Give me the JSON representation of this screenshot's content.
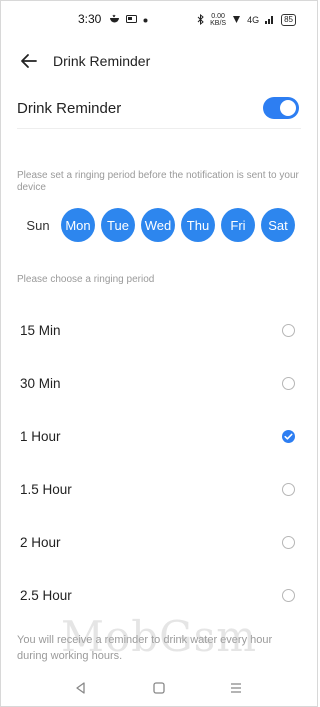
{
  "status_bar": {
    "time": "3:30",
    "notification_icons": [
      "rice-bowl-icon",
      "cast-icon",
      "dot-icon"
    ],
    "speed_value": "0.00",
    "speed_unit": "KB/S",
    "network": "4G",
    "battery": "85"
  },
  "header": {
    "title": "Drink Reminder"
  },
  "toggle": {
    "label": "Drink Reminder",
    "enabled": true
  },
  "days_hint": "Please set a ringing period before the notification is sent to your device",
  "days": [
    {
      "label": "Sun",
      "selected": false
    },
    {
      "label": "Mon",
      "selected": true
    },
    {
      "label": "Tue",
      "selected": true
    },
    {
      "label": "Wed",
      "selected": true
    },
    {
      "label": "Thu",
      "selected": true
    },
    {
      "label": "Fri",
      "selected": true
    },
    {
      "label": "Sat",
      "selected": true
    }
  ],
  "period_hint": "Please choose a ringing period",
  "periods": [
    {
      "label": "15 Min",
      "selected": false
    },
    {
      "label": "30 Min",
      "selected": false
    },
    {
      "label": "1 Hour",
      "selected": true
    },
    {
      "label": "1.5 Hour",
      "selected": false
    },
    {
      "label": "2 Hour",
      "selected": false
    },
    {
      "label": "2.5 Hour",
      "selected": false
    }
  ],
  "footer_note": "You will receive a reminder to drink water every hour during working hours.",
  "watermark": "MobGsm",
  "colors": {
    "accent": "#2d7ef2",
    "day_selected": "#2d86ee",
    "hint": "#9a9a9a"
  }
}
